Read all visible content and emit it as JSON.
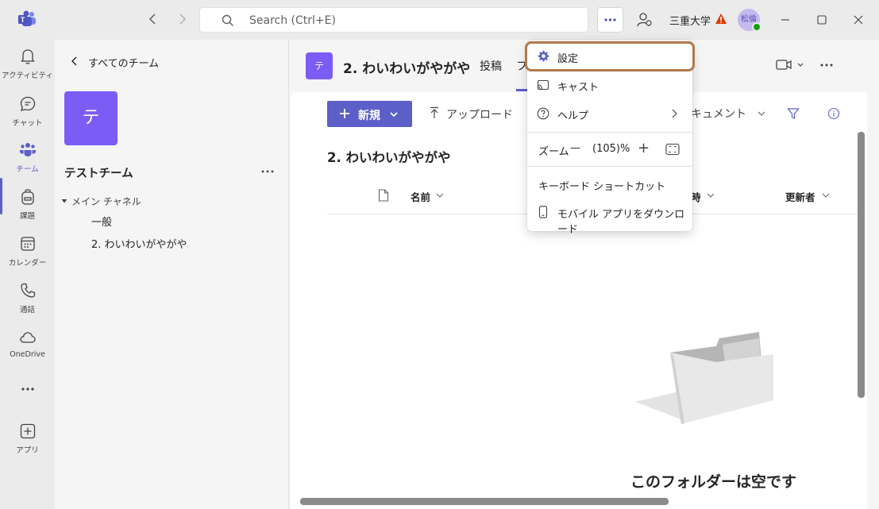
{
  "titlebar": {
    "search_placeholder": "Search (Ctrl+E)",
    "org_name": "三重大学",
    "avatar_initials": "松倫"
  },
  "rail": {
    "items": [
      {
        "label": "アクティビティ",
        "icon": "bell-icon"
      },
      {
        "label": "チャット",
        "icon": "chat-icon"
      },
      {
        "label": "チーム",
        "icon": "teams-icon",
        "active": true
      },
      {
        "label": "課題",
        "icon": "backpack-icon"
      },
      {
        "label": "カレンダー",
        "icon": "calendar-icon"
      },
      {
        "label": "通話",
        "icon": "phone-icon"
      },
      {
        "label": "OneDrive",
        "icon": "cloud-icon"
      },
      {
        "label": "",
        "icon": "more-icon"
      },
      {
        "label": "アプリ",
        "icon": "add-app-icon"
      }
    ]
  },
  "teampanel": {
    "back_label": "すべてのチーム",
    "team_initial": "テ",
    "team_name": "テストチーム",
    "section": "メイン チャネル",
    "channels": [
      "一般",
      "2. わいわいがやがや"
    ]
  },
  "channel_header": {
    "avatar_initial": "テ",
    "title": "2. わいわいがやがや",
    "tab_posts": "投稿",
    "tab_files_partial": "フ"
  },
  "toolbar": {
    "new_label": "新規",
    "upload_label": "アップロード",
    "document_label": "キュメント"
  },
  "files": {
    "folder_title": "2. わいわいがやがや",
    "col_name": "名前",
    "col_modified": "時",
    "col_modified_by": "更新者",
    "empty_text": "このフォルダーは空です"
  },
  "menu": {
    "settings": "設定",
    "cast": "キャスト",
    "help": "ヘルプ",
    "zoom_label": "ズーム",
    "zoom_minus": "—",
    "zoom_value": "(105)%",
    "zoom_plus": "+",
    "shortcuts": "キーボード ショートカット",
    "mobile": "モバイル アプリをダウンロード"
  },
  "colors": {
    "brand": "#5b5fc7",
    "team_avatar": "#7b5cf5",
    "highlight_ring": "#b07a4a",
    "warning": "#d83b01",
    "presence": "#13a10e"
  }
}
